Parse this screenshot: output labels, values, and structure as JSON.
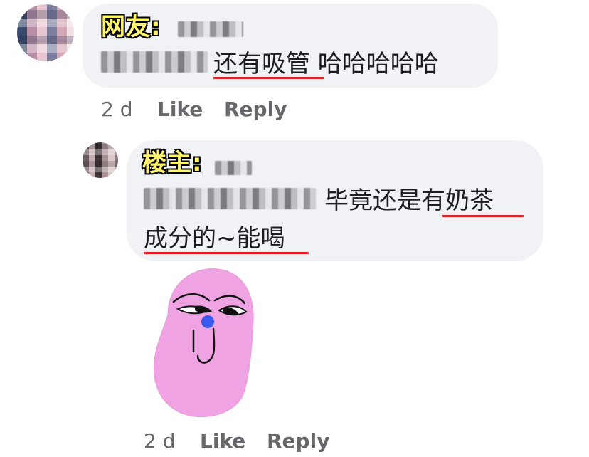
{
  "comment_1": {
    "tag": "网友:",
    "text": "还有吸管 哈哈哈哈哈",
    "time": "2 d",
    "like_label": "Like",
    "reply_label": "Reply"
  },
  "comment_2": {
    "tag": "楼主:",
    "text_line_1": "毕竟还是有奶茶",
    "text_line_2": "成分的~能喝",
    "time": "2 d",
    "like_label": "Like",
    "reply_label": "Reply"
  },
  "colors": {
    "bubble_bg": "#f0f2f5",
    "tag_fill": "#fff46a",
    "underline": "#e41e26",
    "meta_text": "#65676b",
    "sticker_body": "#f0a3e3",
    "sticker_nose": "#3b5bf0"
  },
  "icons": {
    "sticker": "pink-face-sticker"
  }
}
